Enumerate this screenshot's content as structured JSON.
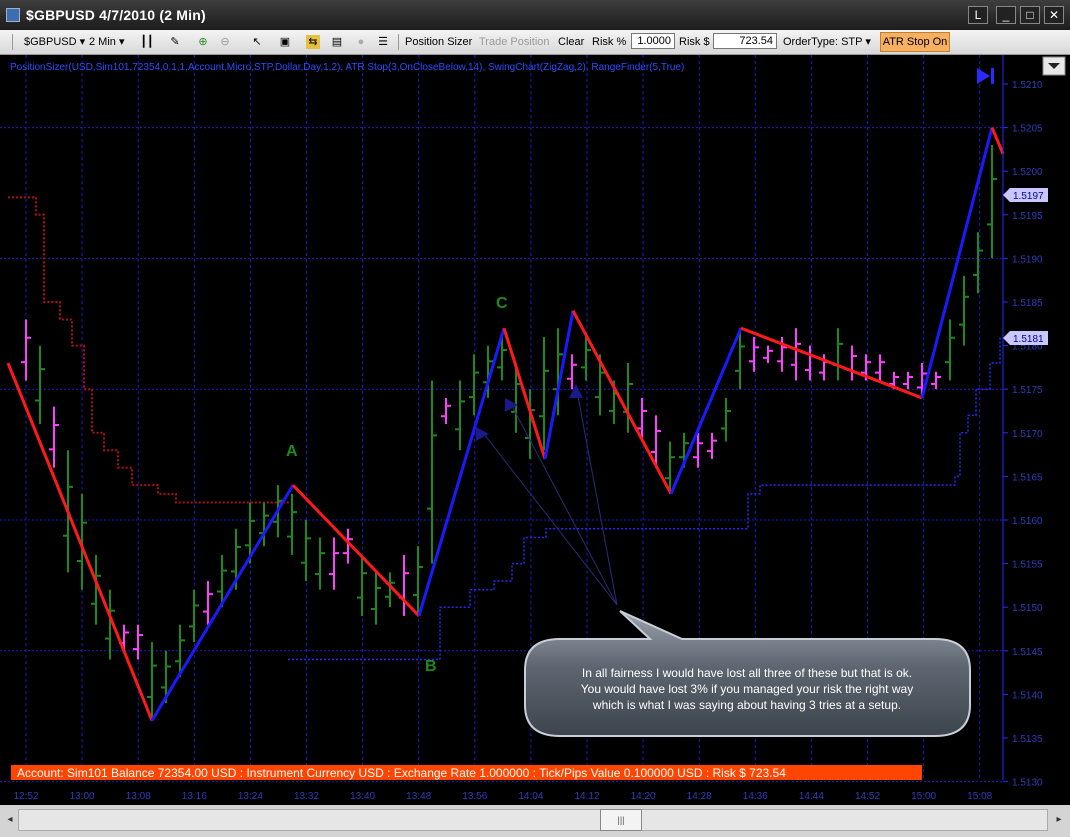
{
  "window": {
    "title": "$GBPUSD  4/7/2010 (2 Min)",
    "buttons": {
      "l": "L",
      "minimize": "_",
      "maximize": "□",
      "close": "✕"
    }
  },
  "toolbar": {
    "instrument": "$GBPUSD",
    "interval": "2 Min",
    "position_sizer": "Position Sizer",
    "trade_position": "Trade Position",
    "clear": "Clear",
    "risk_pct_label": "Risk %",
    "risk_pct_value": "1.0000",
    "risk_usd_label": "Risk $",
    "risk_usd_value": "723.54",
    "order_type": "OrderType: STP",
    "atr_stop": "ATR Stop On"
  },
  "chart": {
    "indicator_line": "PositionSizer(USD,Sim101,72354,0,1,1,Account,Micro,STP,Dollar,Day,1,2), ATR Stop(3,OnCloseBelow,14), SwingChart(ZigZag,2), RangeFinder(5,True)",
    "price_labels": [
      "1.5210",
      "1.5205",
      "1.5200",
      "1.5195",
      "1.5190",
      "1.5185",
      "1.5180",
      "1.5175",
      "1.5170",
      "1.5165",
      "1.5160",
      "1.5155",
      "1.5150",
      "1.5145",
      "1.5140",
      "1.5135",
      "1.5130"
    ],
    "time_labels": [
      "12:52",
      "13:00",
      "13:08",
      "13:16",
      "13:24",
      "13:32",
      "13:40",
      "13:48",
      "13:56",
      "14:04",
      "14:12",
      "14:20",
      "14:28",
      "14:36",
      "14:44",
      "14:52",
      "15:00",
      "15:08"
    ],
    "price_tag_1": "1.5197",
    "price_tag_2": "1.5181",
    "labels": {
      "a": "A",
      "b": "B",
      "c": "C"
    },
    "callout": [
      "In all fairness I would have lost all three of these but that is ok.",
      "You would have lost 3% if you managed your risk the right way",
      "which is what I was saying about having 3 tries at a setup."
    ],
    "account_bar": "Account: Sim101 Balance 72354.00 USD : Instrument Currency USD : Exchange Rate 1.000000 : Tick/Pips Value 0.100000 USD : Risk $ 723.54",
    "colors": {
      "up_leg": "#1a1aff",
      "down_leg": "#ff1a1a",
      "bar_green": "#1e8a1e",
      "bar_magenta": "#ff40ff",
      "grid": "#1c1cc8",
      "account_bg": "#ff4500"
    }
  }
}
